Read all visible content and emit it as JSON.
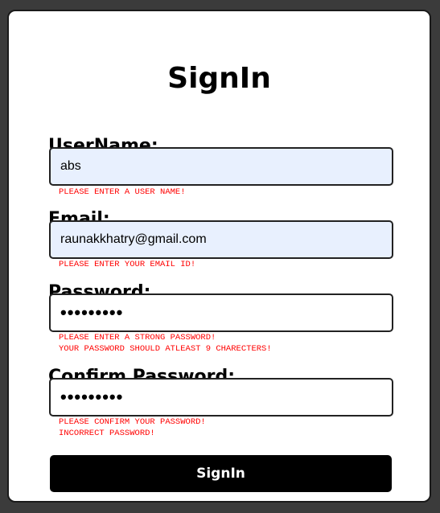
{
  "form": {
    "title": "SignIn",
    "username": {
      "label": "UserName:",
      "value": "abs",
      "errors": [
        "PLEASE ENTER A USER NAME!"
      ]
    },
    "email": {
      "label": "Email:",
      "value": "raunakkhatry@gmail.com",
      "errors": [
        "PLEASE ENTER YOUR EMAIL ID!"
      ]
    },
    "password": {
      "label": "Password:",
      "value": "•••••••••",
      "errors": [
        "PLEASE ENTER A STRONG PASSWORD!",
        "YOUR PASSWORD SHOULD ATLEAST 9 CHARECTERS!"
      ]
    },
    "confirm_password": {
      "label": "Confirm Password:",
      "value": "•••••••••",
      "errors": [
        "PLEASE CONFIRM YOUR PASSWORD!",
        "INCORRECT PASSWORD!"
      ]
    },
    "submit_label": "SignIn"
  },
  "colors": {
    "background": "#3b3b3b",
    "card": "#ffffff",
    "autofill": "#e8f0fe",
    "error": "#ff0000",
    "button": "#000000"
  }
}
